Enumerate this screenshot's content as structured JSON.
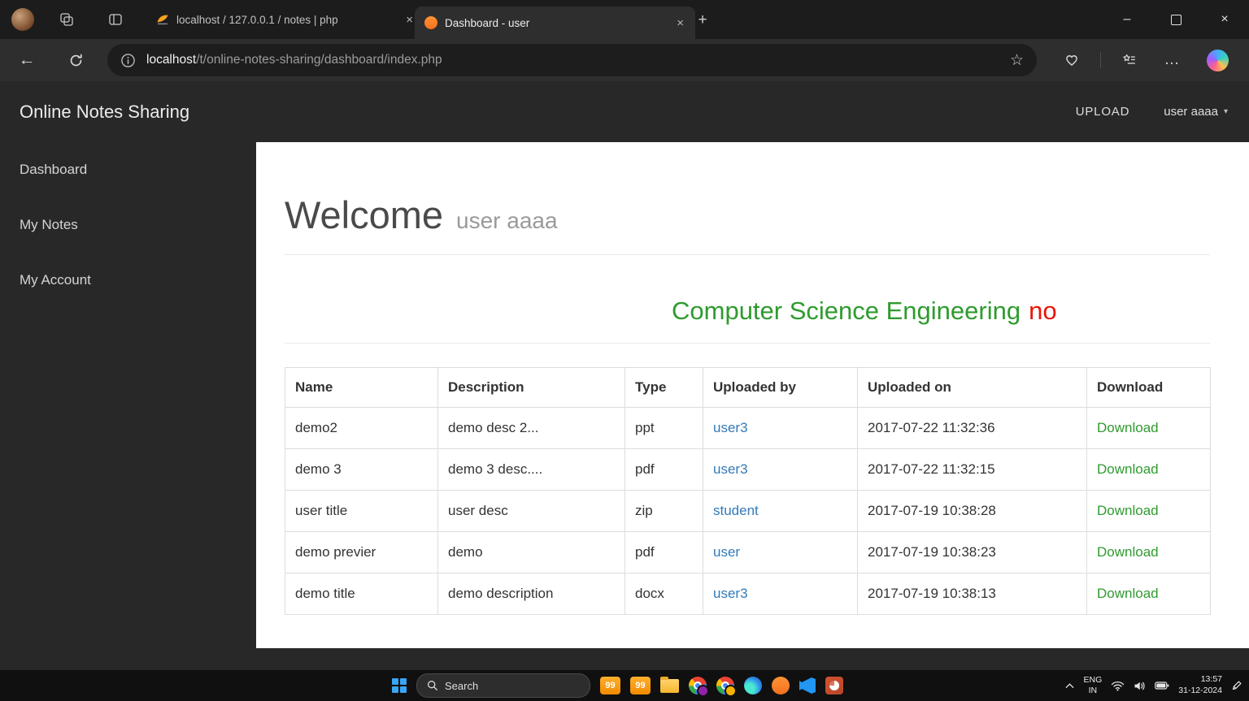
{
  "browser": {
    "tab1": {
      "title": "localhost / 127.0.0.1 / notes | php"
    },
    "tab2": {
      "title": "Dashboard - user"
    },
    "url": {
      "host": "localhost",
      "path": "/t/online-notes-sharing/dashboard/index.php"
    }
  },
  "glyphs": {
    "close": "×",
    "new_tab": "+",
    "minimize": "–",
    "back": "←",
    "more": "…",
    "caret_down": "▾",
    "star": "☆"
  },
  "app": {
    "navbar": {
      "brand": "Online Notes Sharing",
      "upload_label": "UPLOAD",
      "user_label": "user aaaa"
    },
    "sidebar": {
      "items": [
        "Dashboard",
        "My Notes",
        "My Account"
      ]
    },
    "welcome": {
      "title": "Welcome",
      "user": "user aaaa"
    },
    "notes_heading": {
      "green": "Computer Science Engineering",
      "red": "no"
    },
    "table": {
      "headers": [
        "Name",
        "Description",
        "Type",
        "Uploaded by",
        "Uploaded on",
        "Download"
      ],
      "download_label": "Download",
      "rows": [
        {
          "name": "demo2",
          "description": "demo desc 2...",
          "type": "ppt",
          "uploaded_by": "user3",
          "uploaded_on": "2017-07-22 11:32:36"
        },
        {
          "name": "demo 3",
          "description": "demo 3 desc....",
          "type": "pdf",
          "uploaded_by": "user3",
          "uploaded_on": "2017-07-22 11:32:15"
        },
        {
          "name": "user title",
          "description": "user desc",
          "type": "zip",
          "uploaded_by": "student",
          "uploaded_on": "2017-07-19 10:38:28"
        },
        {
          "name": "demo previer",
          "description": "demo",
          "type": "pdf",
          "uploaded_by": "user",
          "uploaded_on": "2017-07-19 10:38:23"
        },
        {
          "name": "demo title",
          "description": "demo description",
          "type": "docx",
          "uploaded_by": "user3",
          "uploaded_on": "2017-07-19 10:38:13"
        }
      ]
    },
    "colors": {
      "heading_green": "#2e9b2e",
      "heading_red": "#ea1508",
      "uploader_link_blue": "#337ab7",
      "download_link_green": "#2f9b2f"
    }
  },
  "taskbar": {
    "search_label": "Search",
    "widget_badges": [
      "99",
      "99"
    ],
    "tray": {
      "lang_line1": "ENG",
      "lang_line2": "IN",
      "time": "13:57",
      "date": "31-12-2024"
    }
  }
}
